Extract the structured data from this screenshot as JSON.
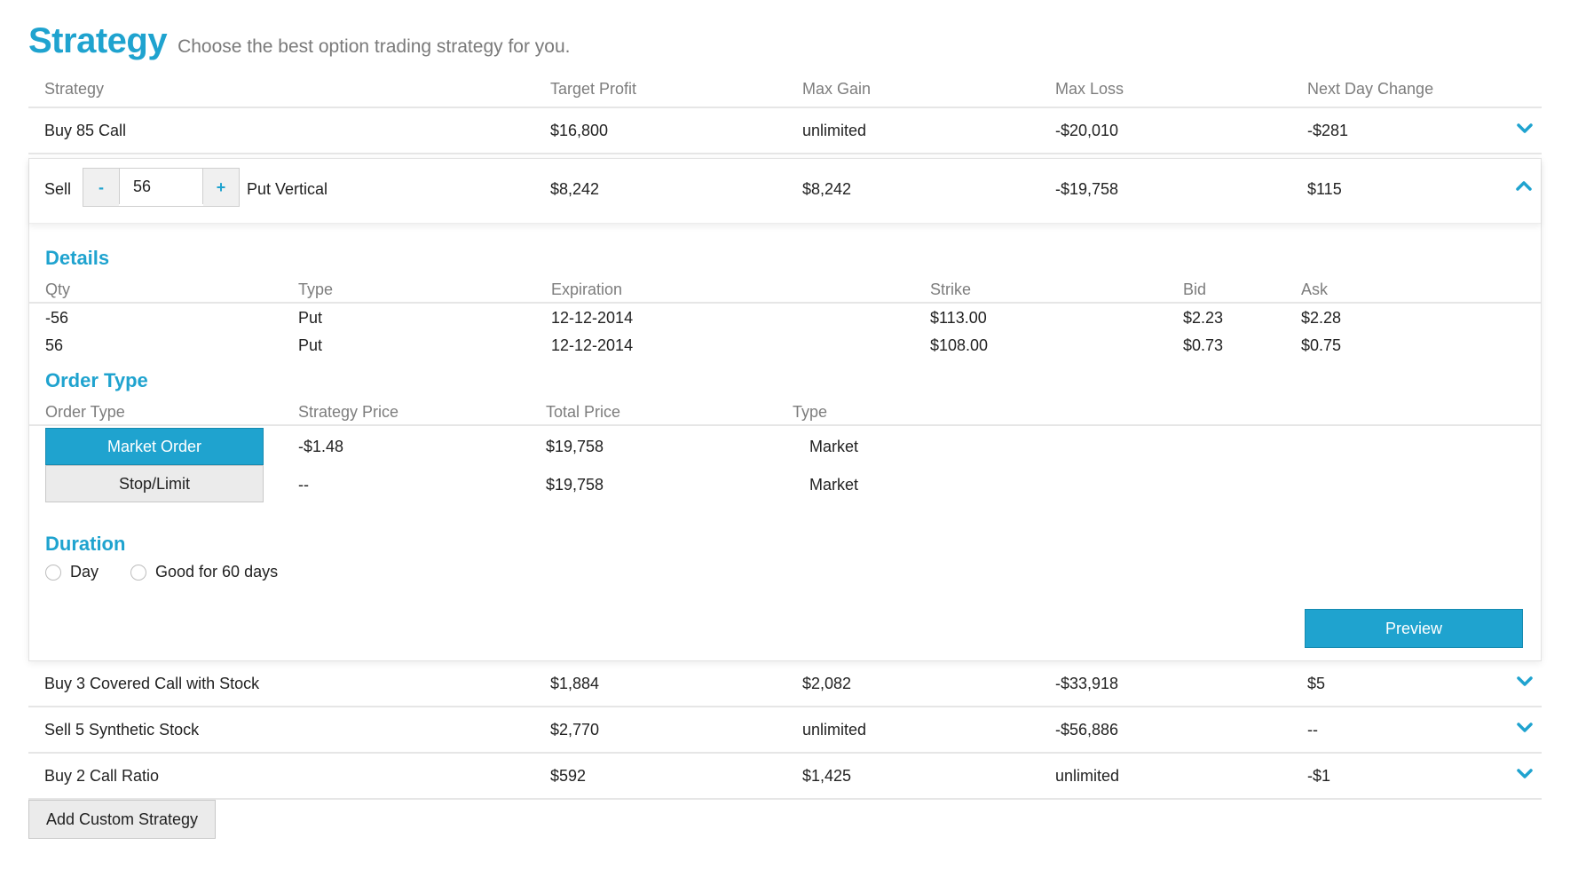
{
  "header": {
    "title": "Strategy",
    "subtitle": "Choose the best option trading strategy for you."
  },
  "columns": [
    "Strategy",
    "Target Profit",
    "Max Gain",
    "Max Loss",
    "Next Day Change"
  ],
  "rows": [
    {
      "strategy": "Buy 85 Call",
      "target_profit": "$16,800",
      "max_gain": "unlimited",
      "max_loss": "-$20,010",
      "next_day_change": "-$281"
    },
    {
      "strategy": "Buy 3 Covered Call with Stock",
      "target_profit": "$1,884",
      "max_gain": "$2,082",
      "max_loss": "-$33,918",
      "next_day_change": "$5"
    },
    {
      "strategy": "Sell 5 Synthetic Stock",
      "target_profit": "$2,770",
      "max_gain": "unlimited",
      "max_loss": "-$56,886",
      "next_day_change": "--"
    },
    {
      "strategy": "Buy 2 Call Ratio",
      "target_profit": "$592",
      "max_gain": "$1,425",
      "max_loss": "unlimited",
      "next_day_change": "-$1"
    }
  ],
  "expanded": {
    "action": "Sell",
    "minus_label": "-",
    "plus_label": "+",
    "quantity": "56",
    "strategy_name": "Put Vertical",
    "target_profit": "$8,242",
    "max_gain": "$8,242",
    "max_loss": "-$19,758",
    "next_day_change": "$115",
    "details": {
      "title": "Details",
      "columns": [
        "Qty",
        "Type",
        "Expiration",
        "Strike",
        "Bid",
        "Ask"
      ],
      "rows": [
        [
          "-56",
          "Put",
          "12-12-2014",
          "$113.00",
          "$2.23",
          "$2.28"
        ],
        [
          "56",
          "Put",
          "12-12-2014",
          "$108.00",
          "$0.73",
          "$0.75"
        ]
      ]
    },
    "order_type": {
      "title": "Order Type",
      "columns": [
        "Order Type",
        "Strategy Price",
        "Total Price",
        "Type"
      ],
      "rows": [
        {
          "label": "Market Order",
          "strategy_price": "-$1.48",
          "total_price": "$19,758",
          "type": "Market"
        },
        {
          "label": "Stop/Limit",
          "strategy_price": "--",
          "total_price": "$19,758",
          "type": "Market"
        }
      ]
    },
    "duration": {
      "title": "Duration",
      "options": [
        "Day",
        "Good for 60 days"
      ]
    },
    "preview_label": "Preview"
  },
  "add_custom_label": "Add Custom Strategy",
  "colors": {
    "accent": "#1fa3cf"
  },
  "icons": {
    "collapsed": "chevron-down-icon",
    "expanded": "chevron-up-icon"
  }
}
